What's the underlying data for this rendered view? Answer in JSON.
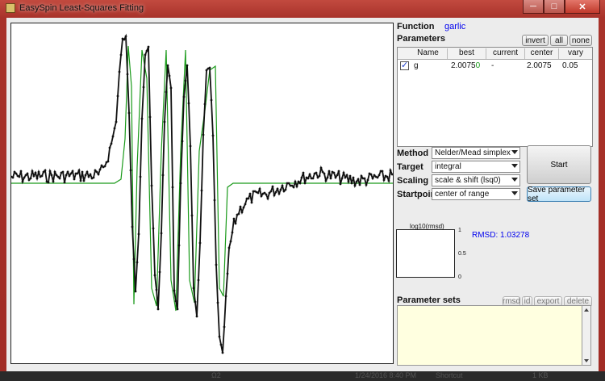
{
  "window": {
    "title": "EasySpin Least-Squares Fitting",
    "min_label": "─",
    "max_label": "□",
    "close_label": "✕"
  },
  "function": {
    "label": "Function",
    "value": "garlic"
  },
  "parameters": {
    "label": "Parameters",
    "buttons": {
      "invert": "invert",
      "all": "all",
      "none": "none"
    },
    "columns": [
      "Name",
      "best",
      "current",
      "center",
      "vary"
    ],
    "rows": [
      {
        "checked": true,
        "name": "g",
        "best": "2.00750",
        "current": "-",
        "center": "2.0075",
        "vary": "0.05"
      }
    ]
  },
  "method": {
    "label": "Method",
    "value": "Nelder/Mead simplex"
  },
  "target": {
    "label": "Target",
    "value": "integral"
  },
  "scaling": {
    "label": "Scaling",
    "value": "scale & shift (lsq0)"
  },
  "startpoint": {
    "label": "Startpoint",
    "value": "center of range"
  },
  "actions": {
    "start": "Start",
    "save": "Save parameter set"
  },
  "rmsd_plot": {
    "title": "log10(rmsd)",
    "ticks": [
      "1",
      "0.5",
      "0"
    ]
  },
  "rmsd": {
    "text": "RMSD: 1.03278"
  },
  "parameter_sets": {
    "label": "Parameter sets",
    "buttons": {
      "rmsd": "rmsd",
      "id": "id",
      "export": "export",
      "delete": "delete"
    }
  },
  "taskbar": {
    "items": [
      "Ω2",
      "1/24/2016 8:40 PM",
      "Shortcut",
      "1 KB"
    ]
  },
  "colors": {
    "experimental": "#111111",
    "simulated": "#1a9a1a",
    "fn_value": "#0000ee"
  }
}
